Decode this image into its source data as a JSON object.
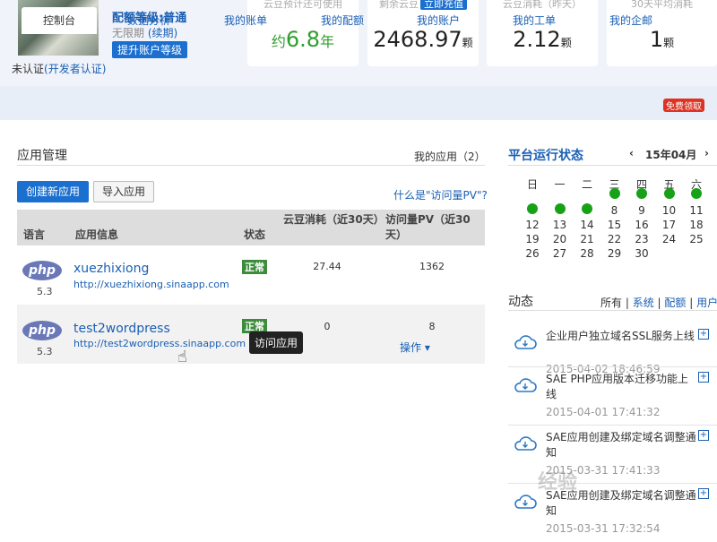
{
  "profile": {
    "level": "配额等级:普通",
    "period_text": "无限期",
    "period_link": "(续期)",
    "upgrade_label": "提升账户等级",
    "unverified_text": "未认证",
    "unverified_link": "(开发者认证)"
  },
  "stats": [
    {
      "label": "云豆预计还可使用",
      "prefix": "约",
      "value": "6.8",
      "unit": "年"
    },
    {
      "label": "剩余云豆",
      "action": "立即充值",
      "value": "2468.97",
      "unit": "颗"
    },
    {
      "label": "云豆消耗（昨天）",
      "value": "2.12",
      "unit": "颗"
    },
    {
      "label": "30天平均消耗",
      "value": "1",
      "unit": "颗"
    }
  ],
  "tabs": [
    "控制台",
    "数据分析",
    "我的账单",
    "我的配额",
    "我的账户",
    "我的工单",
    "我的企邮"
  ],
  "free_badge": "免费领取",
  "app_mgmt": {
    "title": "应用管理",
    "my_apps": "我的应用（2）",
    "create_btn": "创建新应用",
    "import_btn": "导入应用",
    "pv_help": "什么是\"访问量PV\"?",
    "headers": {
      "lang": "语言",
      "info": "应用信息",
      "status": "状态",
      "beans": "云豆消耗（近30天）",
      "pv": "访问量PV（近30天）"
    },
    "rows": [
      {
        "lang": "php",
        "version": "5.3",
        "name": "xuezhixiong",
        "url": "http://xuezhixiong.sinaapp.com",
        "status": "正常",
        "beans": "27.44",
        "pv": "1362"
      },
      {
        "lang": "php",
        "version": "5.3",
        "name": "test2wordpress",
        "url": "http://test2wordpress.sinaapp.com",
        "status": "正常",
        "beans": "0",
        "pv": "8",
        "ops": "操作"
      }
    ],
    "tooltip": "访问应用"
  },
  "platform": {
    "title": "平台运行状态",
    "month": "15年04月",
    "weekdays": [
      "日",
      "一",
      "二",
      "三",
      "四",
      "五",
      "六"
    ],
    "week1_dots": [
      false,
      false,
      false,
      true,
      true,
      true,
      true
    ],
    "week2_dots": [
      true,
      true,
      true,
      "8",
      "9",
      "10",
      "11"
    ],
    "week2_nums": [
      "",
      "",
      "",
      "8",
      "9",
      "10",
      "11"
    ],
    "rows": [
      [
        "12",
        "13",
        "14",
        "15",
        "16",
        "17",
        "18"
      ],
      [
        "19",
        "20",
        "21",
        "22",
        "23",
        "24",
        "25"
      ],
      [
        "26",
        "27",
        "28",
        "29",
        "30",
        "",
        ""
      ]
    ]
  },
  "feed": {
    "title": "动态",
    "filters": [
      "所有",
      "系统",
      "配额",
      "用户"
    ],
    "items": [
      {
        "title": "企业用户独立域名SSL服务上线",
        "time": "2015-04-02 18:46:59"
      },
      {
        "title": "SAE PHP应用版本迁移功能上线",
        "time": "2015-04-01 17:41:32"
      },
      {
        "title": "SAE应用创建及绑定域名调整通知",
        "time": "2015-03-31 17:41:33"
      },
      {
        "title": "SAE应用创建及绑定域名调整通知",
        "time": "2015-03-31 17:32:54"
      }
    ]
  },
  "watermark": "经验"
}
